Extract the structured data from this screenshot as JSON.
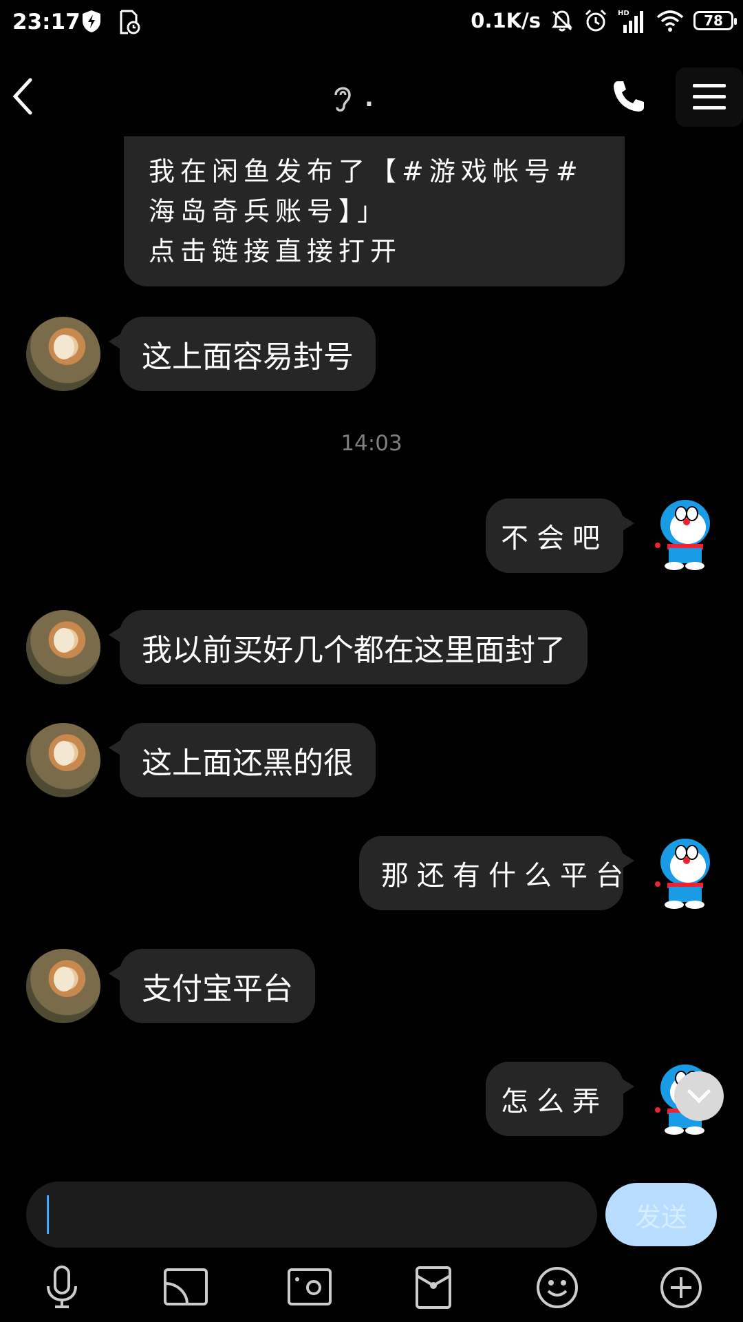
{
  "status_bar": {
    "time": "23:17",
    "speed": "0.1K/s",
    "battery": "78",
    "hd": "HD"
  },
  "header": {
    "title": "."
  },
  "messages": {
    "m0": "我在闲鱼发布了【#游戏帐号#海岛奇兵账号】」\n点击链接直接打开",
    "m1": "这上面容易封号",
    "ts": "14:03",
    "m2": "不会吧",
    "m3": "我以前买好几个都在这里面封了",
    "m4": "这上面还黑的很",
    "m5": "那还有什么平台",
    "m6": "支付宝平台",
    "m7": "怎么弄"
  },
  "input": {
    "send_label": "发送"
  },
  "colors": {
    "bubble": "#262626",
    "send_button": "#b8dcff",
    "cursor": "#3fa8ff"
  },
  "icons": [
    "back-icon",
    "ear-icon",
    "phone-icon",
    "menu-icon",
    "mic-icon",
    "screen-share-icon",
    "photo-icon",
    "red-packet-icon",
    "emoji-icon",
    "plus-icon",
    "scroll-down-icon"
  ]
}
